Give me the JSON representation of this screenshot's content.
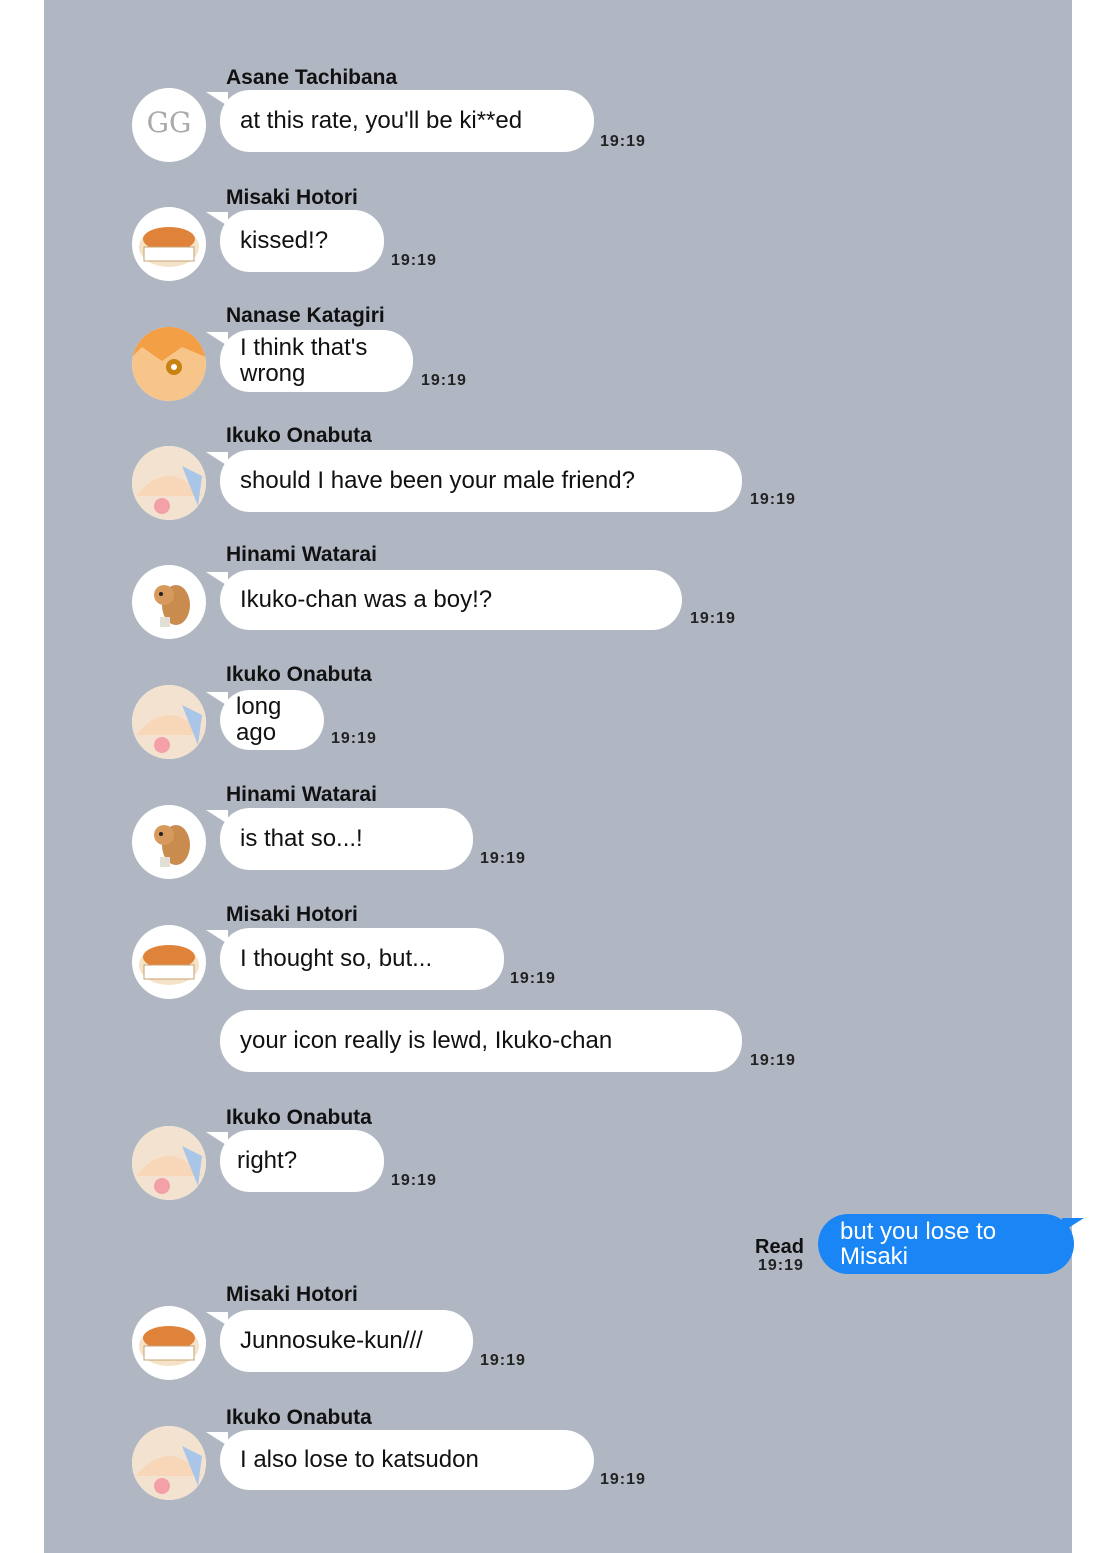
{
  "messages": [
    {
      "sender": "Asane Tachibana",
      "text": "at this rate, you'll be ki**ed",
      "time": "19:19",
      "avatar": "gg-logo-icon"
    },
    {
      "sender": "Misaki Hotori",
      "text": "kissed!?",
      "time": "19:19",
      "avatar": "katsudon-icon"
    },
    {
      "sender": "Nanase Katagiri",
      "text": "I think that's wrong",
      "time": "19:19",
      "avatar": "anime-girl-icon"
    },
    {
      "sender": "Ikuko Onabuta",
      "text": "should I have been your male friend?",
      "time": "19:19",
      "avatar": "ikuko-icon"
    },
    {
      "sender": "Hinami Watarai",
      "text": "Ikuko-chan was a boy!?",
      "time": "19:19",
      "avatar": "squirrel-icon"
    },
    {
      "sender": "Ikuko Onabuta",
      "text": "long ago",
      "time": "19:19",
      "avatar": "ikuko-icon"
    },
    {
      "sender": "Hinami Watarai",
      "text": "is that so...!",
      "time": "19:19",
      "avatar": "squirrel-icon"
    },
    {
      "sender": "Misaki Hotori",
      "text": "I thought so, but...",
      "time": "19:19",
      "avatar": "katsudon-icon"
    },
    {
      "sender": "",
      "text": "your icon really is lewd, Ikuko-chan",
      "time": "19:19",
      "avatar": ""
    },
    {
      "sender": "Ikuko Onabuta",
      "text": "right?",
      "time": "19:19",
      "avatar": "ikuko-icon"
    },
    {
      "sender": "Misaki Hotori",
      "text": "Junnosuke-kun///",
      "time": "19:19",
      "avatar": "katsudon-icon"
    },
    {
      "sender": "Ikuko Onabuta",
      "text": "I also lose to katsudon",
      "time": "19:19",
      "avatar": "ikuko-icon"
    }
  ],
  "own_message": {
    "text": "but you lose to Misaki",
    "status": "Read",
    "time": "19:19"
  },
  "colors": {
    "chat_background": "#b1b7c2",
    "incoming_bubble": "#ffffff",
    "outgoing_bubble": "#1a86f5"
  }
}
